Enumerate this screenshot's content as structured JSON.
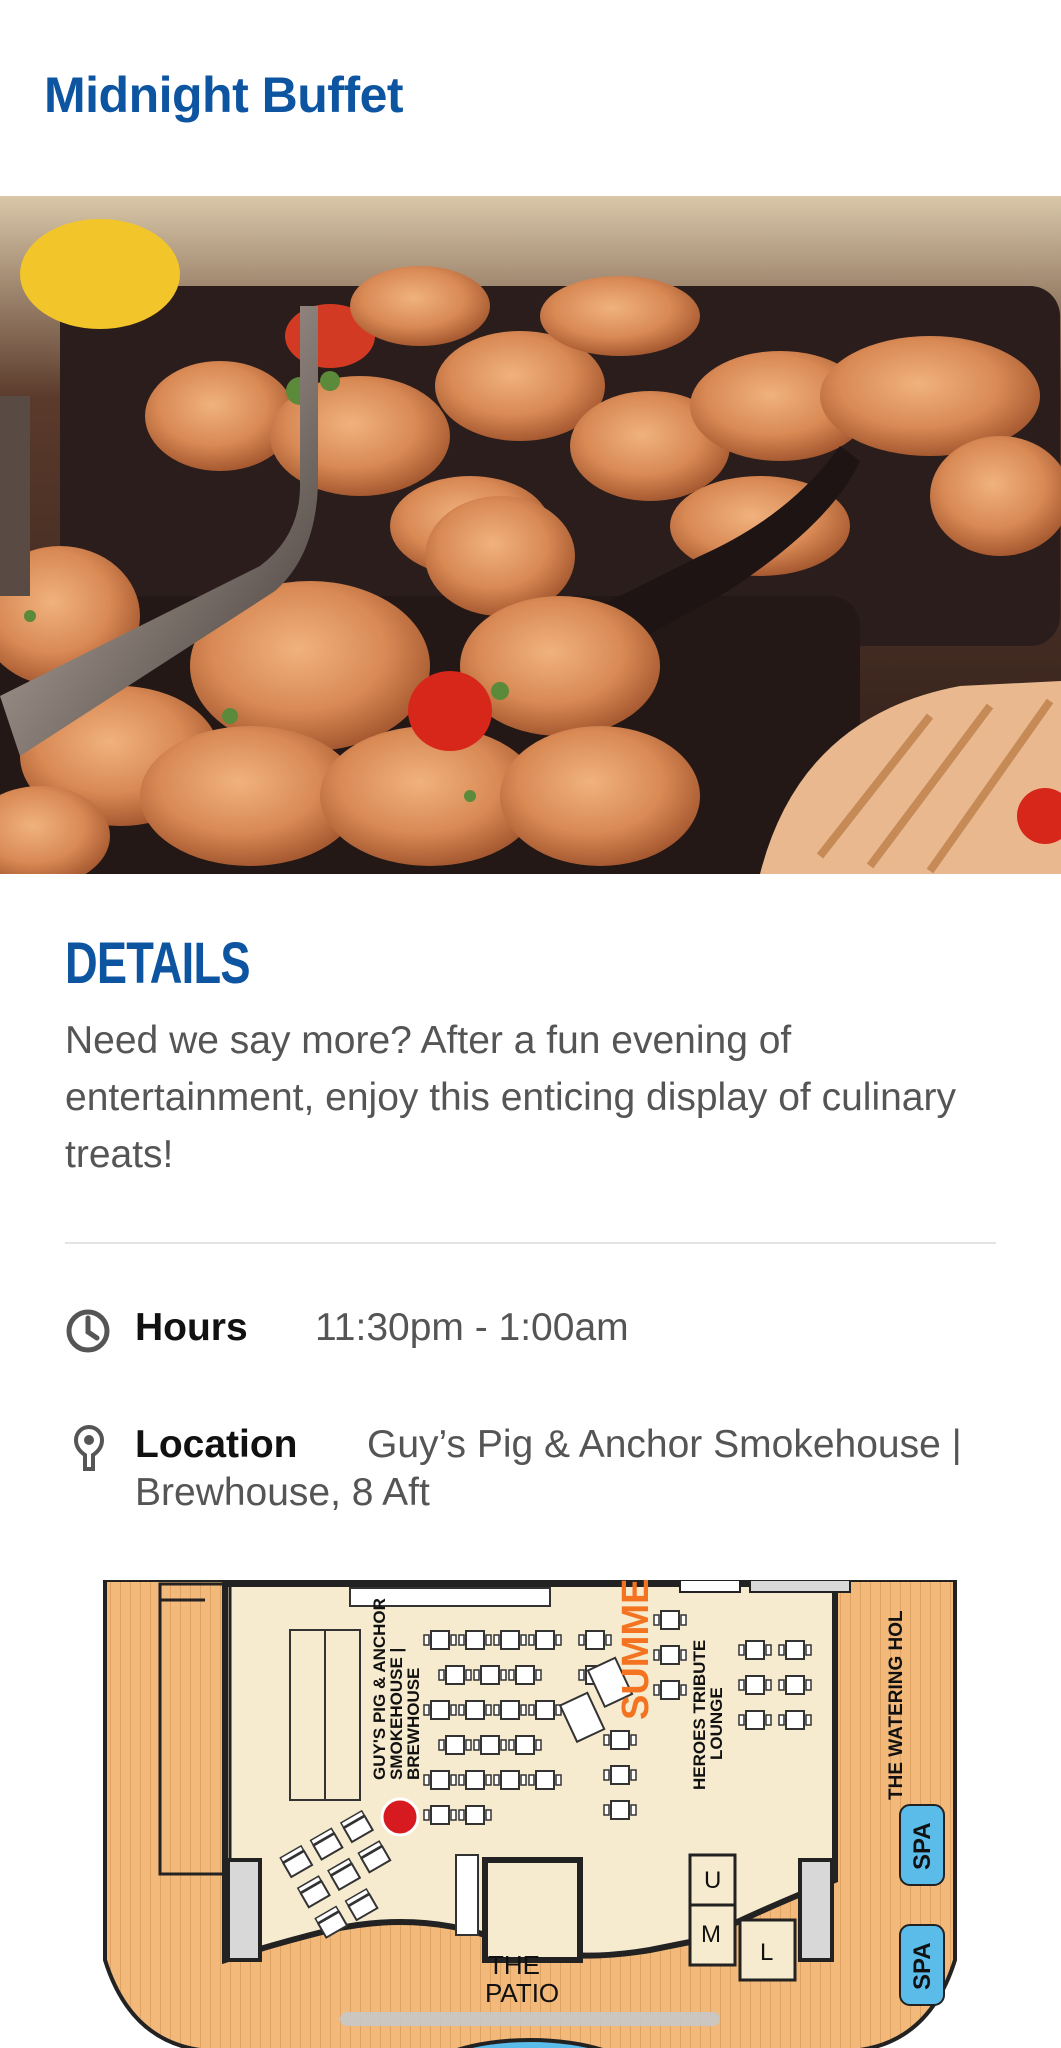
{
  "header": {
    "title": "Midnight Buffet"
  },
  "hero": {
    "image_alt": ""
  },
  "details": {
    "heading": "DETAILS",
    "description": "Need we say more? After a fun evening of entertainment, enjoy this enticing display of culinary treats!"
  },
  "hours": {
    "icon": "clock-icon",
    "label": "Hours",
    "value": "11:30pm - 1:00am"
  },
  "location": {
    "icon": "location-pin-icon",
    "label": "Location",
    "value_line1": "Guy’s Pig & Anchor Smokehouse |",
    "value_line2": "Brewhouse, 8 Aft"
  },
  "map": {
    "venue_label_1": "GUY'S PIG & ANCHOR",
    "venue_label_2": "SMOKEHOUSE |",
    "venue_label_3": "BREWHOUSE",
    "summer_label": "SUMME",
    "lounge_label_1": "HEROES TRIBUTE",
    "lounge_label_2": "LOUNGE",
    "watering_label": "THE WATERING HOL",
    "patio_label_1": "THE",
    "patio_label_2": "PATIO",
    "spa_label": "SPA",
    "size_u": "U",
    "size_m": "M",
    "size_l": "L"
  },
  "colors": {
    "brand_blue": "#0d54a1",
    "text_gray": "#555555",
    "deck_orange": "#f2b97a",
    "floor_cream": "#f7ebcf",
    "marker_red": "#d71920",
    "spa_blue": "#5bbce9"
  }
}
